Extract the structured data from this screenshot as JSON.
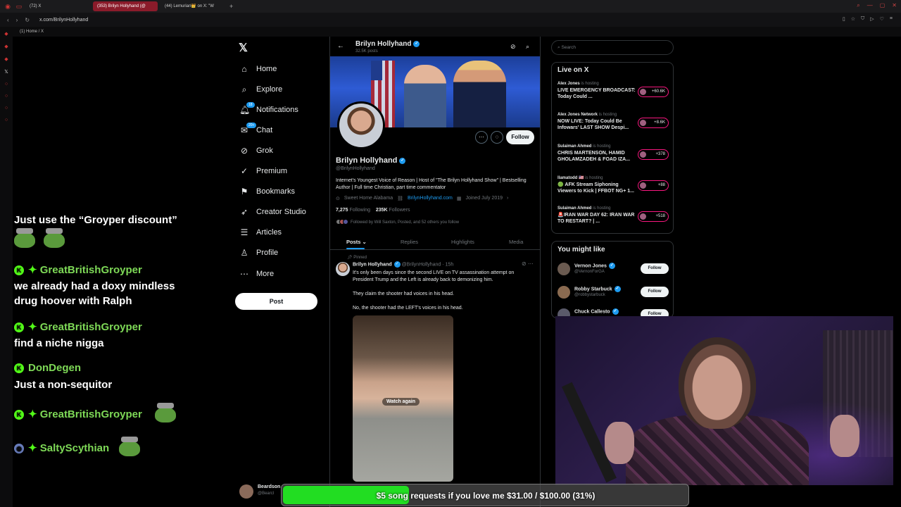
{
  "browser": {
    "tabs": [
      {
        "label": "(72) X"
      },
      {
        "label": "(353) Brilyn Hollyhand (@"
      },
      {
        "label": "(44) Lemurian👑 on X: \"W"
      }
    ],
    "url": "x.com/BrilynHollyhand",
    "bookmark": "(1) Home / X"
  },
  "nav": {
    "items": [
      {
        "label": "Home",
        "icon": "home-icon"
      },
      {
        "label": "Explore",
        "icon": "search-icon"
      },
      {
        "label": "Notifications",
        "icon": "bell-icon",
        "badge": "18"
      },
      {
        "label": "Chat",
        "icon": "chat-icon",
        "badge": "20+"
      },
      {
        "label": "Grok",
        "icon": "grok-icon"
      },
      {
        "label": "Premium",
        "icon": "premium-icon"
      },
      {
        "label": "Bookmarks",
        "icon": "bookmark-icon"
      },
      {
        "label": "Creator Studio",
        "icon": "rocket-icon"
      },
      {
        "label": "Articles",
        "icon": "articles-icon"
      },
      {
        "label": "Profile",
        "icon": "profile-icon"
      },
      {
        "label": "More",
        "icon": "more-icon"
      }
    ],
    "post_label": "Post"
  },
  "chat": [
    {
      "user": "",
      "text": "Just use the “Groyper discount”"
    },
    {
      "user": "GreatBritishGroyper",
      "text": "we already had a doxy mindless"
    },
    {
      "user": "",
      "text": "drug hoover with Ralph"
    },
    {
      "user": "GreatBritishGroyper",
      "text": "find a niche nigga"
    },
    {
      "user": "DonDegen",
      "text": "Just a non-sequitor"
    },
    {
      "user": "GreatBritishGroyper",
      "text": ""
    },
    {
      "user": "SaltyScythian",
      "text": ""
    }
  ],
  "profile": {
    "header_name": "Brilyn Hollyhand",
    "header_posts": "32.5K posts",
    "name": "Brilyn Hollyhand",
    "handle": "@BrilynHollyhand",
    "bio": "Internet's Youngest Voice of Reason | Host of \"The Brilyn Hollyhand Show\" | Bestselling Author | Full time Christian, part time commentator",
    "location": "Sweet Home Alabama",
    "link": "BrilynHollyhand.com",
    "joined": "Joined July 2019",
    "following_count": "7,275",
    "following_label": "Following",
    "followers_count": "235K",
    "followers_label": "Followers",
    "followed_by": "Followed by Will Saxton, Posted, and 52 others you follow",
    "follow_label": "Follow",
    "tabs": [
      "Posts",
      "Replies",
      "Highlights",
      "Media"
    ]
  },
  "tweet": {
    "pinned": "Pinned",
    "name": "Brilyn Hollyhand",
    "handle_time": "@BrilynHollyhand · 15h",
    "text1": "It's only been days since the second LIVE on TV assassination attempt on President Trump and the Left is already back to demonizing him.",
    "text2": "They claim the shooter had voices in his head.",
    "text3": "No, the shooter had the LEFT's voices in his head.",
    "watch_again": "Watch again"
  },
  "sidebar": {
    "search_placeholder": "Search",
    "live_title": "Live on X",
    "live": [
      {
        "host": "Alex Jones",
        "status": "is hosting",
        "title": "LIVE EMERGENCY BROADCAST: Today Could ...",
        "count": "+60.6K"
      },
      {
        "host": "Alex Jones Network",
        "status": "is hosting",
        "title": "NOW LIVE: Today Could Be Infowars' LAST SHOW Despi...",
        "count": "+8.6K"
      },
      {
        "host": "Sulaiman Ahmed",
        "status": "is hosting",
        "title": "CHRIS MARTENSON, HAMID GHOLAMZADEH & FOAD IZA...",
        "count": "+378"
      },
      {
        "host": "llamatodd 🇺🇸",
        "status": "is hosting",
        "title": "🟢 AFK Stream Siphoning Viewers to Kick | FFBOT NG+ 1...",
        "count": "+88"
      },
      {
        "host": "Sulaiman Ahmed",
        "status": "is hosting",
        "title": "🚨IRAN WAR DAY 62: IRAN WAR TO RESTART? | ...",
        "count": "+518"
      }
    ],
    "wtf_title": "You might like",
    "wtf": [
      {
        "name": "Vernon Jones",
        "handle": "@VernonForGA",
        "button": "Follow"
      },
      {
        "name": "Robby Starbuck",
        "handle": "@robbystarbuck",
        "button": "Follow"
      },
      {
        "name": "Chuck Callesto",
        "handle": "",
        "button": "Follow"
      }
    ]
  },
  "bottom_account": {
    "name": "Beardson",
    "handle": "@Bearcl"
  },
  "goal": {
    "text": "$5 song requests if you love me $31.00 / $100.00 (31%)",
    "progress": 0.31
  },
  "colors": {
    "accent": "#1d9bf0",
    "goal_fill": "#22dd22",
    "chat_name": "#7ed957",
    "tab_active": "#8b1b2a"
  }
}
